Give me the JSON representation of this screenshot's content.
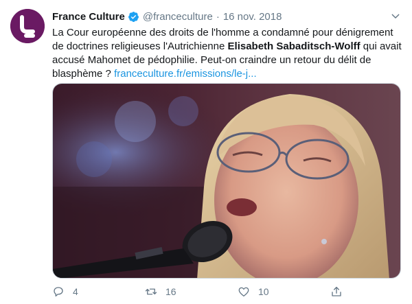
{
  "tweet": {
    "author_name": "France Culture",
    "handle": "@franceculture",
    "separator": "·",
    "date": "16 nov. 2018",
    "text": {
      "line1": "La Cour européenne des droits de l'homme a condamné pour dénigrement",
      "line2_before": "de doctrines religieuses l'Autrichienne ",
      "line2_bold": "Elisabeth Sabaditsch-Wolff",
      "line2_after": " qui avait",
      "line3": "accusé Mahomet de pédophilie. Peut-on craindre un retour du délit de",
      "line4_before": "blasphème ? ",
      "link": "franceculture.fr/emissions/le-j..."
    }
  },
  "actions": {
    "reply_count": "4",
    "retweet_count": "16",
    "like_count": "10"
  },
  "icons": {
    "avatar": "france-culture-logo",
    "verified": "verified-badge-icon",
    "caret": "chevron-down-icon",
    "reply": "reply-icon",
    "retweet": "retweet-icon",
    "like": "heart-icon",
    "share": "share-icon"
  },
  "colors": {
    "brand": "#6a1a63",
    "verified": "#1da1f2",
    "link": "#1b95e0",
    "muted": "#657786",
    "text": "#14171a"
  }
}
